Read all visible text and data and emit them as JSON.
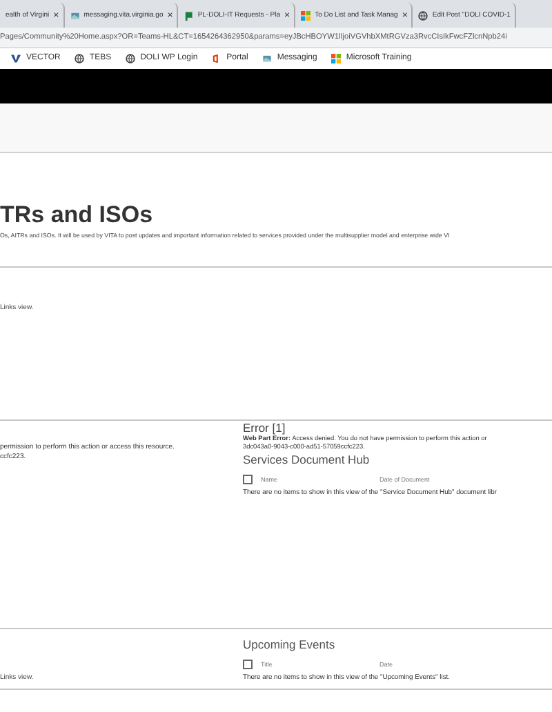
{
  "tabs": [
    {
      "title": "ealth of Virgini",
      "kind": "none",
      "close": "×",
      "selected": false
    },
    {
      "title": "messaging.vita.virginia.go",
      "kind": "page",
      "close": "×",
      "selected": false
    },
    {
      "title": "PL-DOLI-IT Requests - Pla",
      "kind": "flag",
      "close": "×",
      "selected": false
    },
    {
      "title": "To Do List and Task Manag",
      "kind": "tiles",
      "close": "×",
      "selected": false
    },
    {
      "title": "Edit Post \"DOLI COVID-1",
      "kind": "globe",
      "selected": false
    }
  ],
  "address": "Pages/Community%20Home.aspx?OR=Teams-HL&CT=1654264362950&params=eyJBcHBOYW1lIjoiVGVhbXMtRGVza3RvcCIsIkFwcFZlcnNpb24i",
  "bookmarks": [
    {
      "label": "VECTOR",
      "kind": "v"
    },
    {
      "label": "TEBS",
      "kind": "globe"
    },
    {
      "label": "DOLI WP Login",
      "kind": "globe"
    },
    {
      "label": "Portal",
      "kind": "office"
    },
    {
      "label": "Messaging",
      "kind": "page"
    },
    {
      "label": "Microsoft Training",
      "kind": "tiles"
    }
  ],
  "page": {
    "title": "TRs and ISOs",
    "description": "Os, AITRs and ISOs. It will be used by VITA to post updates and important information related to services provided under the multisupplier model and enterprise wide VI",
    "left_top": "Links view.",
    "left_error_lines": [
      "permission to perform this action or access this resource.",
      "ccfc223."
    ],
    "left_bottom": "Links view.",
    "error": {
      "heading": "Error [1]",
      "message": "**Web Part Error:** Access denied. You do not have permission to perform this action or",
      "id": "3dc043a0-9043-c000-ad51-57059ccfc223."
    },
    "lists": [
      {
        "title": "Services Document Hub",
        "checked": false,
        "columns": [
          "Name",
          "Date of Document"
        ],
        "empty": "There are no items to show in this view of the \"Service Document Hub\" document libr"
      },
      {
        "title": "Upcoming Events",
        "checked": false,
        "columns": [
          "Title",
          "Date"
        ],
        "empty": "There are no items to show in this view of the \"Upcoming Events\" list."
      }
    ]
  }
}
